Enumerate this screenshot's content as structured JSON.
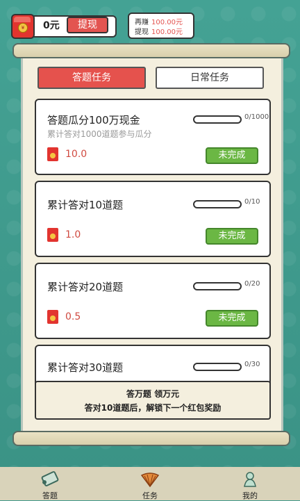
{
  "wallet": {
    "balance": "0元",
    "withdraw_label": "提现",
    "coin_glyph": "¥"
  },
  "notice": {
    "row1_label": "再赚",
    "row1_value": "100.00元",
    "row2_label": "提现",
    "row2_value": "100.00元"
  },
  "tabs": [
    {
      "label": "答题任务",
      "active": true
    },
    {
      "label": "日常任务",
      "active": false
    }
  ],
  "tasks": [
    {
      "title": "答题瓜分100万现金",
      "subtitle": "累计答对1000道题参与瓜分",
      "progress": "0/1000",
      "progress_fraction": 0,
      "reward": "10.0",
      "status": "未完成"
    },
    {
      "title": "累计答对10道题",
      "subtitle": "",
      "progress": "0/10",
      "progress_fraction": 0,
      "reward": "1.0",
      "status": "未完成"
    },
    {
      "title": "累计答对20道题",
      "subtitle": "",
      "progress": "0/20",
      "progress_fraction": 0,
      "reward": "0.5",
      "status": "未完成"
    },
    {
      "title": "累计答对30道题",
      "subtitle": "",
      "progress": "0/30",
      "progress_fraction": 0,
      "reward": "",
      "status": ""
    }
  ],
  "banner": {
    "line1": "答万题 领万元",
    "line2": "答对10道题后，解锁下一个红包奖励"
  },
  "nav": [
    {
      "label": "答题",
      "icon": "scroll-icon"
    },
    {
      "label": "任务",
      "icon": "fan-icon"
    },
    {
      "label": "我的",
      "icon": "jade-figure-icon"
    }
  ],
  "colors": {
    "accent": "#e35450",
    "success": "#6bb744",
    "background": "#3f9a8f"
  }
}
